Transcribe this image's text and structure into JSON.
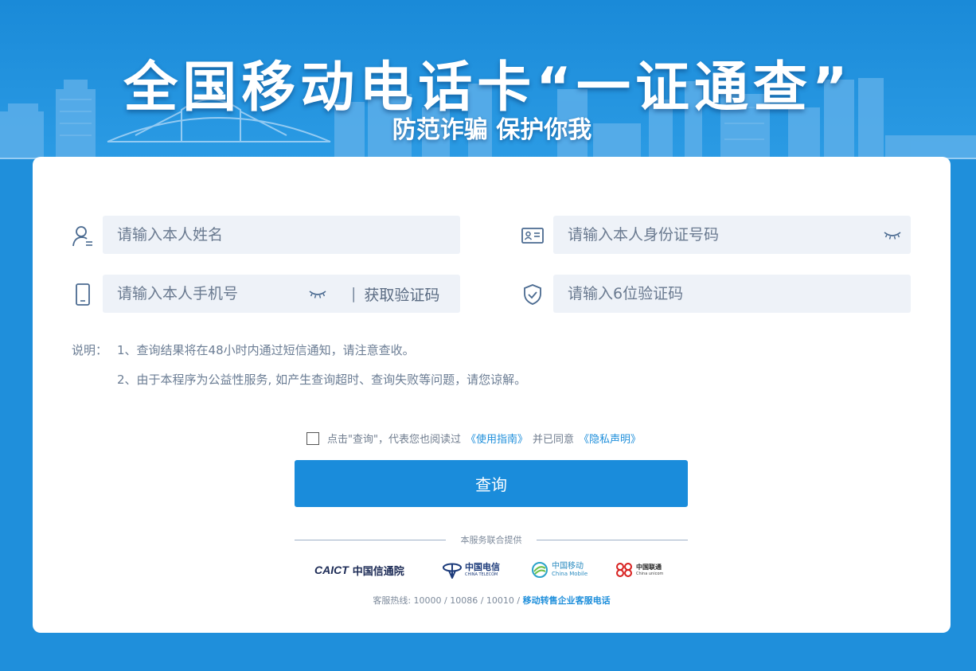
{
  "banner": {
    "title": "全国移动电话卡“一证通查”",
    "subtitle": "防范诈骗 保护你我"
  },
  "form": {
    "name_placeholder": "请输入本人姓名",
    "id_placeholder": "请输入本人身份证号码",
    "phone_placeholder": "请输入本人手机号",
    "get_code_separator": "|",
    "get_code_label": "获取验证码",
    "code_placeholder": "请输入6位验证码"
  },
  "notes": {
    "label": "说明：",
    "lines": [
      "1、查询结果将在48小时内通过短信通知，请注意查收。",
      "2、由于本程序为公益性服务, 如产生查询超时、查询失败等问题，请您谅解。"
    ]
  },
  "agreement": {
    "text_prefix": "点击\"查询\"，代表您也阅读过",
    "guide_link": "《使用指南》",
    "text_middle": "并已同意",
    "privacy_link": "《隐私声明》",
    "checked": false
  },
  "submit_label": "查询",
  "footer": {
    "provided_by": "本服务联合提供",
    "logos": {
      "caict_mark": "CAICT",
      "caict_name": "中国信通院",
      "telecom_cn": "中国电信",
      "telecom_en": "CHINA TELECOM",
      "mobile_cn": "中国移动",
      "mobile_en": "China Mobile",
      "unicom_cn": "中国联通",
      "unicom_en": "China unicom"
    },
    "hotline_prefix": "客服热线: 10000 / 10086 / 10010 /",
    "hotline_link": "移动转售企业客服电话"
  },
  "colors": {
    "background": "#1f8fdb",
    "accent": "#1a8cdb",
    "input_bg": "#eef2f8",
    "icon": "#4a6a90"
  },
  "icons": {
    "name_field": "user-icon",
    "id_field": "id-card-icon",
    "phone_field": "mobile-phone-icon",
    "code_field": "shield-check-icon",
    "visibility": "eye-closed-icon"
  }
}
